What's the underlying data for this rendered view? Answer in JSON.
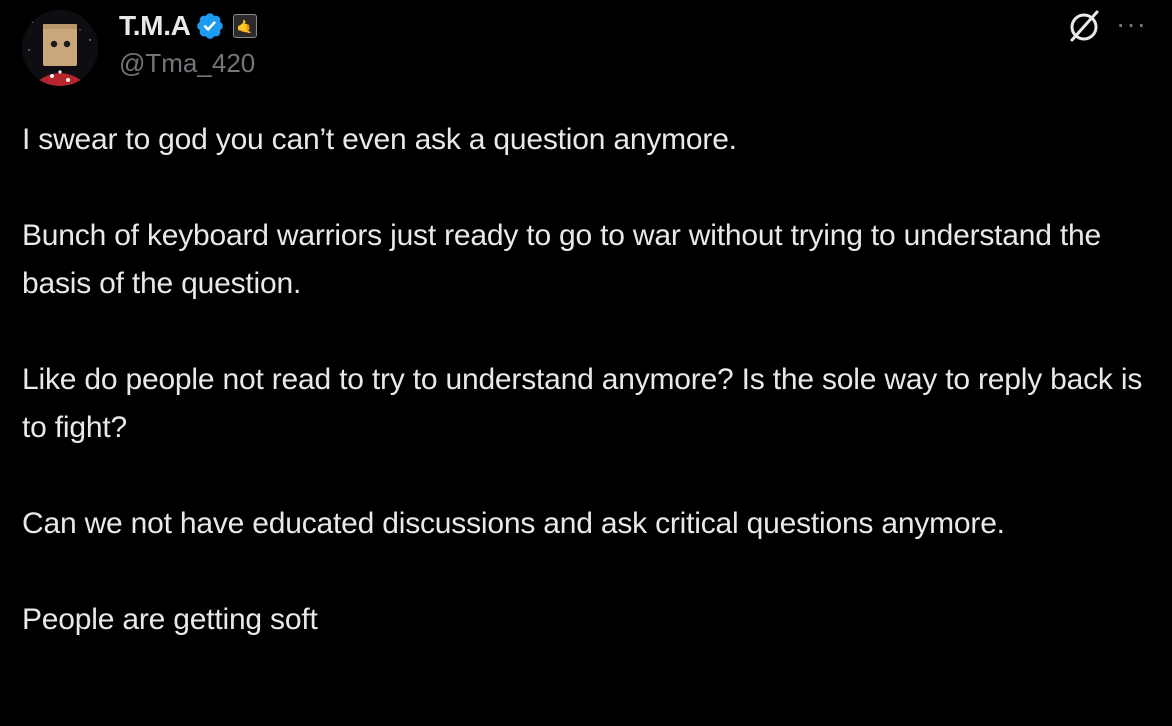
{
  "author": {
    "display_name": "T.M.A",
    "handle": "@Tma_420",
    "verified": true,
    "affiliate_badge_icon": "shaka-hand-icon",
    "avatar_icon": "paper-bag-head-avatar"
  },
  "actions": {
    "grok_icon": "grok-icon",
    "more_icon": "more-options-icon",
    "more_label": "···"
  },
  "colors": {
    "background": "#000000",
    "text_primary": "#e7e9ea",
    "text_secondary": "#71767b",
    "verified_blue": "#1d9bf0"
  },
  "tweet": {
    "paragraphs": [
      "I swear to god you can’t even ask a question anymore.",
      "Bunch of keyboard warriors just ready to go to war without trying to understand the basis of the question.",
      "Like do people not read to try to understand anymore? Is the sole way to reply back is to fight?",
      "Can we not have educated discussions and ask critical questions anymore.",
      "People are getting soft"
    ]
  }
}
